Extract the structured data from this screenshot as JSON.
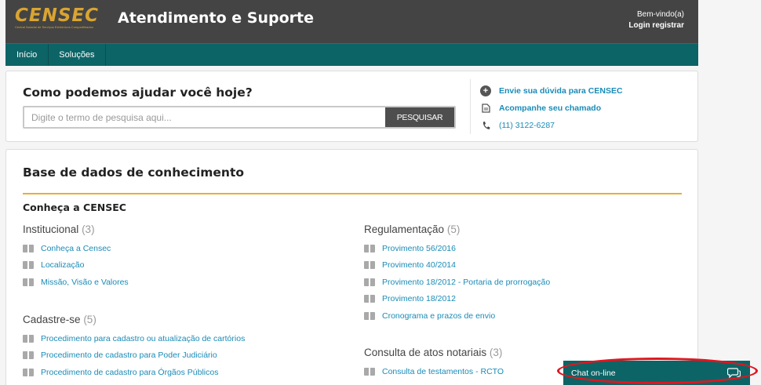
{
  "header": {
    "logo_text": "CENSEC",
    "logo_subtitle": "Central Notarial de Serviços Eletrônicos Compartilhados",
    "title": "Atendimento e Suporte",
    "welcome": "Bem-vindo(a)",
    "login": "Login",
    "register": "registrar"
  },
  "nav": {
    "items": [
      {
        "label": "Início"
      },
      {
        "label": "Soluções"
      }
    ]
  },
  "help": {
    "title": "Como podemos ajudar você hoje?",
    "search_placeholder": "Digite o termo de pesquisa aqui...",
    "search_button": "PESQUISAR",
    "contacts": [
      {
        "label": "Envie sua dúvida para CENSEC",
        "icon": "plus-icon"
      },
      {
        "label": "Acompanhe seu chamado",
        "icon": "document-icon"
      },
      {
        "label": "(11) 3122-6287",
        "icon": "phone-icon"
      }
    ]
  },
  "kb": {
    "title": "Base de dados de conhecimento",
    "section": "Conheça a CENSEC",
    "left": [
      {
        "title": "Institucional",
        "count": "(3)",
        "articles": [
          "Conheça a Censec",
          "Localização",
          "Missão, Visão e Valores"
        ]
      },
      {
        "title": "Cadastre-se",
        "count": "(5)",
        "articles": [
          "Procedimento para cadastro ou atualização de cartórios",
          "Procedimento de cadastro para Poder Judiciário",
          "Procedimento de cadastro para Órgãos Públicos"
        ]
      }
    ],
    "right": [
      {
        "title": "Regulamentação",
        "count": "(5)",
        "articles": [
          "Provimento 56/2016",
          "Provimento 40/2014",
          "Provimento 18/2012 - Portaria de prorrogação",
          "Provimento 18/2012",
          "Cronograma e prazos de envio"
        ]
      },
      {
        "title": "Consulta de atos notariais",
        "count": "(3)",
        "articles": [
          "Consulta de testamentos - RCTO"
        ]
      }
    ]
  },
  "chat": {
    "label": "Chat on-line",
    "icon": "chat-bubble-icon"
  },
  "colors": {
    "header_bg": "#444444",
    "nav_bg": "#0d6466",
    "accent_gold": "#e6b035",
    "link": "#1a8bb7",
    "annotation_red": "#e0161f"
  }
}
